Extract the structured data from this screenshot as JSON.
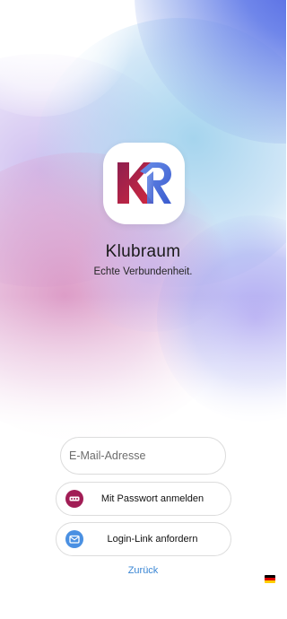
{
  "app": {
    "name": "Klubraum",
    "tagline": "Echte Verbundenheit."
  },
  "form": {
    "email_placeholder": "E-Mail-Adresse",
    "password_button": "Mit Passwort anmelden",
    "login_link_button": "Login-Link anfordern",
    "back_link": "Zurück"
  },
  "icons": {
    "logo": "klubraum-kr-logo",
    "password": "dots-icon",
    "login_link": "mail-link-icon",
    "language": "german-flag-icon"
  },
  "colors": {
    "logo_red": "#c52346",
    "logo_blue": "#4a6ad6",
    "password_icon_bg": "#a11d55",
    "mail_icon_bg": "#4a90e2",
    "link_text": "#3a86d4"
  }
}
